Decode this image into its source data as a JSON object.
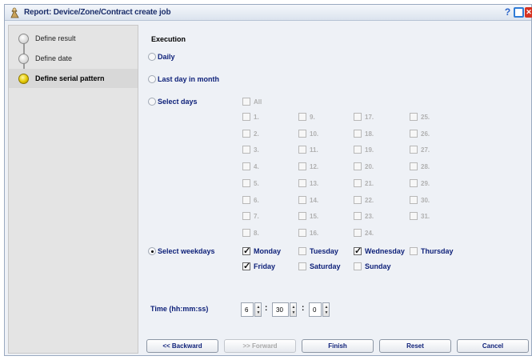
{
  "window": {
    "title": "Report: Device/Zone/Contract create job",
    "help_icon": "help-icon",
    "maximize_icon": "maximize-icon",
    "close_icon": "close-icon",
    "help_glyph": "?",
    "close_glyph": "✕"
  },
  "steps": [
    {
      "label": "Define result",
      "active": false
    },
    {
      "label": "Define date",
      "active": false
    },
    {
      "label": "Define serial pattern",
      "active": true
    }
  ],
  "execution": {
    "title": "Execution",
    "options": {
      "daily": "Daily",
      "last_day": "Last day in month",
      "select_days": "Select days",
      "select_weekdays": "Select weekdays"
    },
    "selected": "select_weekdays",
    "days_all": "All",
    "days": [
      "1.",
      "2.",
      "3.",
      "4.",
      "5.",
      "6.",
      "7.",
      "8.",
      "9.",
      "10.",
      "11.",
      "12.",
      "13.",
      "14.",
      "15.",
      "16.",
      "17.",
      "18.",
      "19.",
      "20.",
      "21.",
      "22.",
      "23.",
      "24.",
      "25.",
      "26.",
      "27.",
      "28.",
      "29.",
      "30.",
      "31."
    ],
    "weekdays": [
      {
        "label": "Monday",
        "checked": true
      },
      {
        "label": "Tuesday",
        "checked": false
      },
      {
        "label": "Wednesday",
        "checked": true
      },
      {
        "label": "Thursday",
        "checked": false
      },
      {
        "label": "Friday",
        "checked": true
      },
      {
        "label": "Saturday",
        "checked": false
      },
      {
        "label": "Sunday",
        "checked": false
      }
    ]
  },
  "time": {
    "label": "Time (hh:mm:ss)",
    "hh": "6",
    "mm": "30",
    "ss": "0",
    "separator": ":"
  },
  "buttons": {
    "backward": "<< Backward",
    "forward": ">> Forward",
    "finish": "Finish",
    "reset": "Reset",
    "cancel": "Cancel"
  },
  "colors": {
    "label_blue": "#0c1f78",
    "active_step": "#e3c800",
    "close_red": "#d63322"
  }
}
